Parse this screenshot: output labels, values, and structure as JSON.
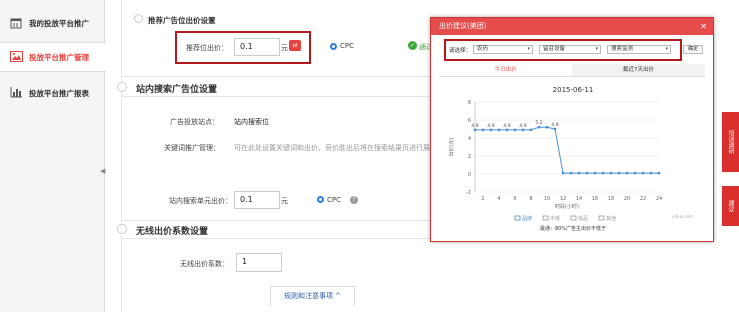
{
  "sidebar": {
    "items": [
      {
        "label": "我的投放平台推广",
        "icon": "calendar-icon"
      },
      {
        "label": "投放平台推广管理",
        "icon": "image-icon",
        "active": true
      },
      {
        "label": "投放平台推广报表",
        "icon": "bar-chart-icon"
      }
    ]
  },
  "sections": {
    "recommend": {
      "title": "推荐广告位出价设置",
      "bid_label": "推荐位出价：",
      "bid_value": "0.1",
      "unit": "元",
      "mode": "CPC",
      "status": "通过"
    },
    "station": {
      "title": "站内搜索广告位设置",
      "site_label": "广告投放站点：",
      "site_value": "站内搜索位",
      "kw_label": "关键词推广管理：",
      "kw_hint": "可在此处设置关键词和出价，竞价胜出后将在搜索结果页进行展示",
      "unit_bid_label": "站内搜索单元出价：",
      "unit_bid_value": "0.1",
      "unit": "元",
      "mode": "CPC"
    },
    "wireless": {
      "title": "无线出价系数设置",
      "coef_label": "无线出价系数：",
      "coef_value": "1"
    },
    "footer_tab": "规则和注意事项 ^"
  },
  "modal": {
    "title": "出价建议(美团)",
    "filter_label": "请选择：",
    "selects": [
      "农药",
      "留驻设备",
      "搜索监测"
    ],
    "confirm": "确定",
    "tabs": [
      "今日出价",
      "截近7天出价"
    ],
    "chart_title": "2015-06-11",
    "caption": "最通：80%广告主出价不低于",
    "watermark": "yihuo.com"
  },
  "right_tabs": [
    "培训调研",
    "建议"
  ],
  "colors": {
    "accent": "#e8423e",
    "chart_line": "#4a8fd6"
  },
  "chart_data": {
    "type": "line",
    "title": "2015-06-11",
    "xlabel": "时段(小时)",
    "ylabel": "出价(元)",
    "categories": [
      "2",
      "4",
      "6",
      "8",
      "10",
      "12",
      "14",
      "16",
      "18",
      "20",
      "22",
      "24"
    ],
    "x": [
      1,
      2,
      3,
      4,
      5,
      6,
      7,
      8,
      9,
      10,
      11,
      12,
      13,
      14,
      15,
      16,
      17,
      18,
      19,
      20,
      21,
      22,
      23,
      24
    ],
    "values": [
      4.9,
      4.9,
      4.9,
      4.9,
      4.9,
      4.9,
      4.9,
      4.9,
      5.2,
      5.2,
      5.0,
      0.1,
      0.1,
      0.1,
      0.1,
      0.1,
      0.1,
      0.1,
      0.1,
      0.1,
      0.1,
      0.1,
      0.1,
      0.1
    ],
    "point_labels": [
      "4.9",
      "4.9",
      "4.9",
      "4.9",
      "5.2",
      "4.9"
    ],
    "yticks": [
      "8",
      "6",
      "4",
      "2",
      "0",
      "-2"
    ],
    "ylim": [
      -2,
      8
    ],
    "legend": [
      "品牌",
      "中低",
      "低品",
      "其他"
    ],
    "grid": true
  }
}
